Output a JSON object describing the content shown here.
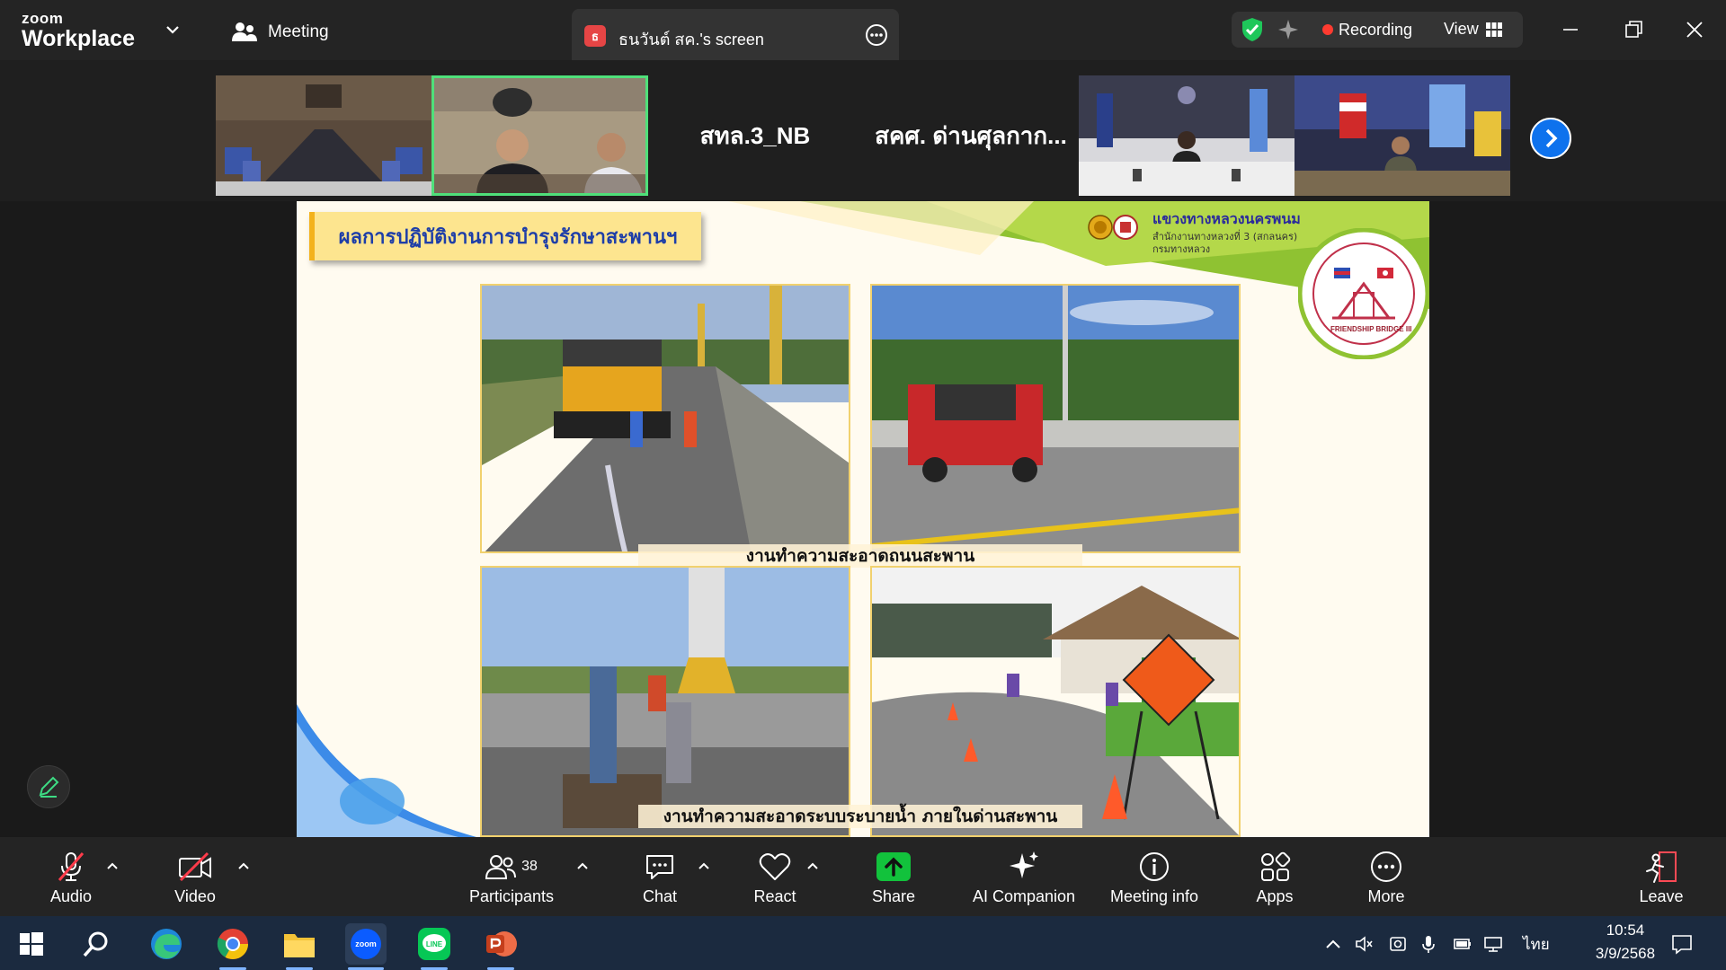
{
  "app": {
    "brand_top": "zoom",
    "brand_bottom": "Workplace"
  },
  "titlebar": {
    "meeting_label": "Meeting",
    "share_badge": "ธ",
    "share_title": "ธนวันต์ สค.'s screen",
    "recording_label": "Recording",
    "view_label": "View"
  },
  "strip": {
    "names": [
      "สทล.3_NB",
      "สคศ. ด่านศุลกาก..."
    ]
  },
  "slide": {
    "title": "ผลการปฏิบัติงานการบำรุงรักษาสะพานฯ",
    "org_name": "แขวงทางหลวงนครพนม",
    "org_sub1": "สำนักงานทางหลวงที่ 3 (สกลนคร)",
    "org_sub2": "กรมทางหลวง",
    "seal_text": "FRIENDSHIP BRIDGE III",
    "caption_top": "งานทำความสะอาดถนนสะพาน",
    "caption_bottom": "งานทำความสะอาดระบบระบายน้ำ ภายในด่านสะพาน"
  },
  "toolbar": {
    "audio": "Audio",
    "video": "Video",
    "participants": "Participants",
    "participants_count": "38",
    "chat": "Chat",
    "react": "React",
    "share": "Share",
    "ai_companion": "AI Companion",
    "meeting_info": "Meeting info",
    "apps": "Apps",
    "more": "More",
    "leave": "Leave"
  },
  "taskbar": {
    "zoom_label": "zoom",
    "line_label": "LINE",
    "lang": "ไทย",
    "time": "10:54",
    "date": "3/9/2568"
  },
  "colors": {
    "accent_blue": "#0e72ed",
    "share_green": "#12c23c",
    "record_red": "#ff3b30",
    "active_thumb": "#4fe07a"
  }
}
